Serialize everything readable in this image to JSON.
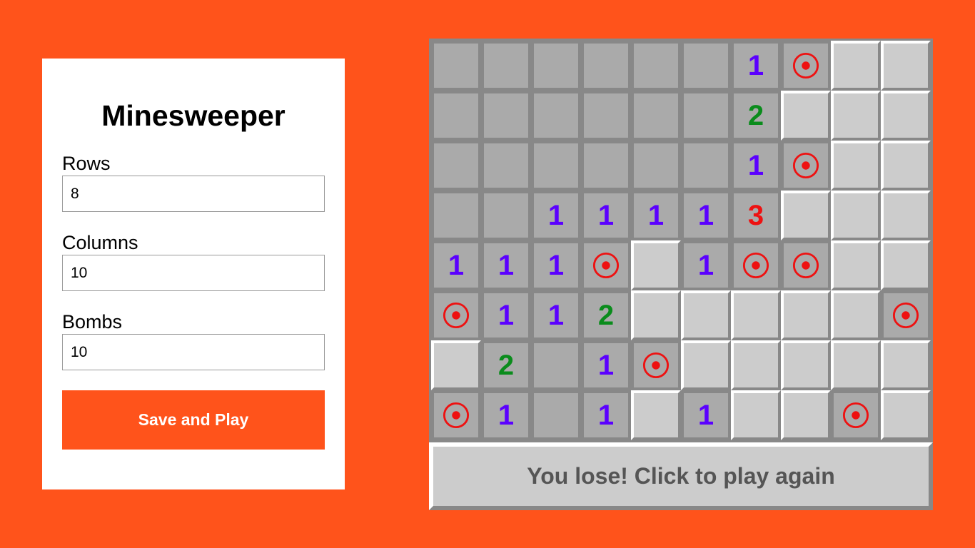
{
  "settings": {
    "title": "Minesweeper",
    "rows_label": "Rows",
    "rows_value": "8",
    "columns_label": "Columns",
    "columns_value": "10",
    "bombs_label": "Bombs",
    "bombs_value": "10",
    "save_label": "Save and Play"
  },
  "game": {
    "status_text": "You lose! Click to play again",
    "cell_icons": {
      "bomb": "bomb-icon"
    },
    "colors": {
      "background": "#ff531b",
      "number_1": "#5b00ff",
      "number_2": "#0a8c1c",
      "number_3": "#ee1111",
      "bomb": "#ee1111",
      "open_cell": "#aaaaaa",
      "closed_cell": "#cccccc"
    },
    "grid": [
      [
        "",
        "",
        "",
        "",
        "",
        "",
        "1",
        "*",
        "#",
        "#"
      ],
      [
        "",
        "",
        "",
        "",
        "",
        "",
        "2",
        "#",
        "#",
        "#"
      ],
      [
        "",
        "",
        "",
        "",
        "",
        "",
        "1",
        "*",
        "#",
        "#"
      ],
      [
        "",
        "",
        "1",
        "1",
        "1",
        "1",
        "3",
        "#",
        "#",
        "#"
      ],
      [
        "1",
        "1",
        "1",
        "*",
        "#",
        "1",
        "*",
        "*",
        "#",
        "#"
      ],
      [
        "*",
        "1",
        "1",
        "2",
        "#",
        "#",
        "#",
        "#",
        "#",
        "*"
      ],
      [
        "#",
        "2",
        "",
        "1",
        "*",
        "#",
        "#",
        "#",
        "#",
        "#"
      ],
      [
        "*",
        "1",
        "",
        "1",
        "#",
        "1",
        "#",
        "#",
        "*",
        "#"
      ]
    ]
  }
}
